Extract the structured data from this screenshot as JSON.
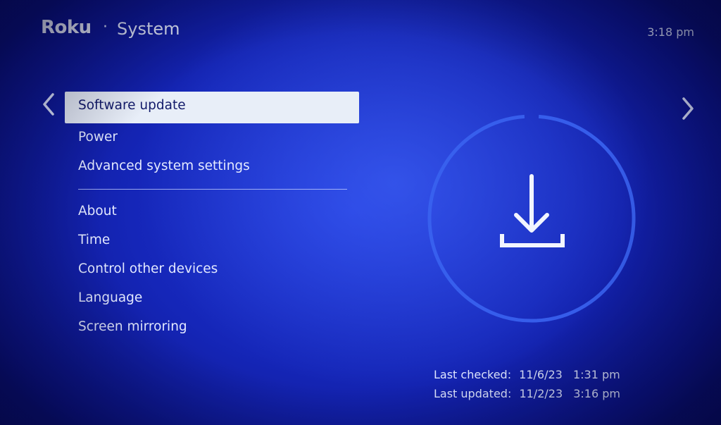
{
  "header": {
    "brand": "Roku",
    "separator": "·",
    "title": "System",
    "clock": "3:18 pm"
  },
  "navigation": {
    "left_icon": "chevron-left-icon",
    "right_icon": "chevron-right-icon"
  },
  "menu": {
    "items": [
      {
        "label": "Software update",
        "selected": true
      },
      {
        "label": "Power"
      },
      {
        "label": "Advanced system settings"
      },
      {
        "label": "About"
      },
      {
        "label": "Time"
      },
      {
        "label": "Control other devices"
      },
      {
        "label": "Language"
      },
      {
        "label": "Screen mirroring"
      }
    ]
  },
  "update_panel": {
    "icon": "download-icon",
    "last_checked_label": "Last checked:",
    "last_checked_date": "11/6/23",
    "last_checked_time": "1:31 pm",
    "last_updated_label": "Last updated:",
    "last_updated_date": "11/2/23",
    "last_updated_time": "3:16 pm"
  },
  "colors": {
    "background": "#1526b8",
    "selection": "#e8eef8",
    "text": "#e3e9ff",
    "selected_text": "#121a6a",
    "ring": "#3a63f0"
  }
}
